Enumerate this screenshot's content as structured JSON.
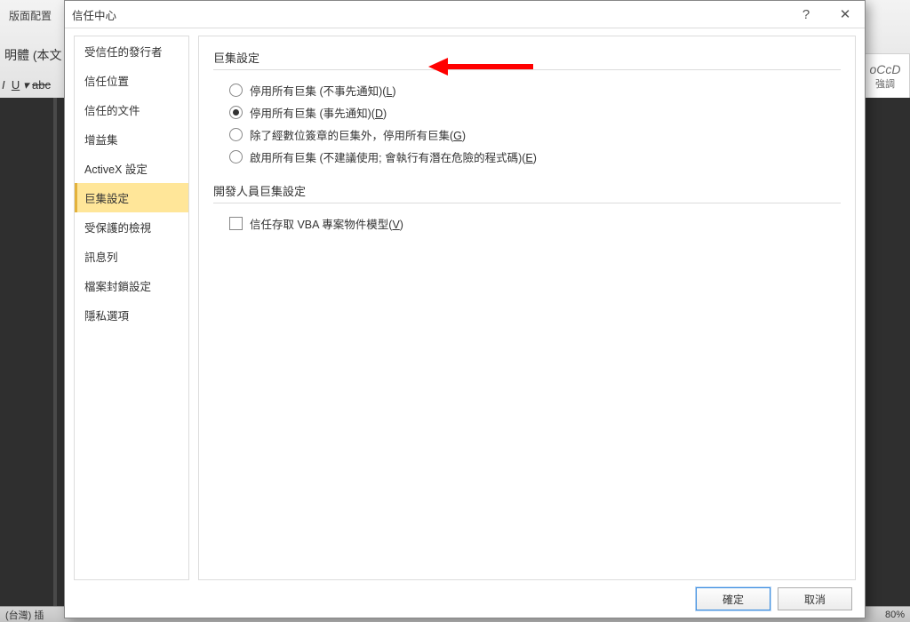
{
  "bg": {
    "ribbon_tab": "版面配置",
    "font_box": "明體 (本文",
    "format_italic": "I",
    "format_underline": "U",
    "format_strike": "abc",
    "style_text1": "oCcD",
    "style_text2": "強調",
    "status_left": "(台灣)  插",
    "status_right": "80%"
  },
  "dialog": {
    "title": "信任中心",
    "help": "?",
    "close": "✕"
  },
  "sidebar": {
    "items": [
      {
        "label": "受信任的發行者"
      },
      {
        "label": "信任位置"
      },
      {
        "label": "信任的文件"
      },
      {
        "label": "增益集"
      },
      {
        "label": "ActiveX 設定"
      },
      {
        "label": "巨集設定",
        "selected": true
      },
      {
        "label": "受保護的檢視"
      },
      {
        "label": "訊息列"
      },
      {
        "label": "檔案封鎖設定"
      },
      {
        "label": "隱私選項"
      }
    ]
  },
  "content": {
    "section1_title": "巨集設定",
    "options": [
      {
        "text": "停用所有巨集 (不事先通知)",
        "accel": "L",
        "checked": false
      },
      {
        "text": "停用所有巨集 (事先通知)",
        "accel": "D",
        "checked": true
      },
      {
        "text": "除了經數位簽章的巨集外，停用所有巨集",
        "accel": "G",
        "checked": false
      },
      {
        "text": "啟用所有巨集 (不建議使用; 會執行有潛在危險的程式碼)",
        "accel": "E",
        "checked": false
      }
    ],
    "section2_title": "開發人員巨集設定",
    "checkbox": {
      "text": "信任存取 VBA 專案物件模型",
      "accel": "V",
      "checked": false
    }
  },
  "footer": {
    "ok": "確定",
    "cancel": "取消"
  }
}
